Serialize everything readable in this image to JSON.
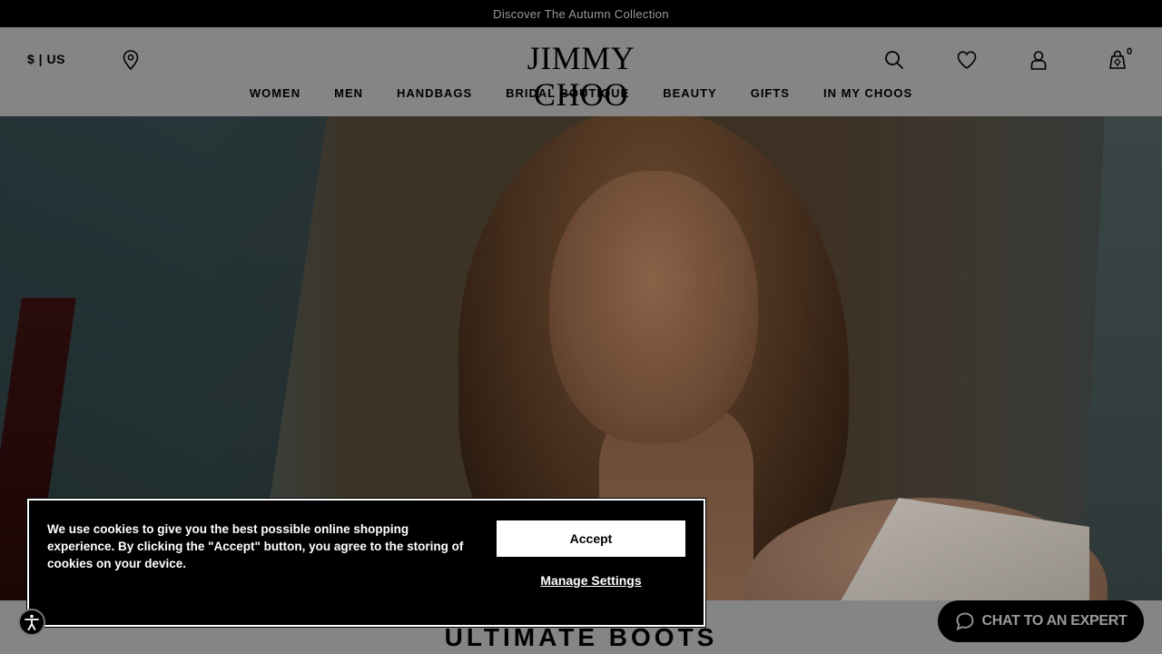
{
  "announcement": "Discover The Autumn Collection",
  "header": {
    "currency": "$ | US",
    "logo": "JIMMY CHOO",
    "cart_count": "0",
    "icons": [
      "store-locator-icon",
      "search-icon",
      "heart-icon",
      "account-icon",
      "cart-icon"
    ]
  },
  "nav": {
    "items": [
      {
        "label": "WOMEN"
      },
      {
        "label": "MEN"
      },
      {
        "label": "HANDBAGS"
      },
      {
        "label": "BRIDAL BOUTIQUE"
      },
      {
        "label": "BEAUTY"
      },
      {
        "label": "GIFTS"
      },
      {
        "label": "IN MY CHOOS"
      }
    ]
  },
  "section": {
    "title": "ULTIMATE BOOTS"
  },
  "cookie_banner": {
    "text": "We use cookies to give you the best possible online shopping experience. By clicking the \"Accept\" button, you agree to the storing of cookies on your device.",
    "accept_label": "Accept",
    "manage_label": "Manage Settings"
  },
  "chat": {
    "label": "CHAT TO AN EXPERT"
  },
  "colors": {
    "overlay_dim": "#858585",
    "banner_bg": "#000000",
    "button_bg": "#ffffff"
  }
}
